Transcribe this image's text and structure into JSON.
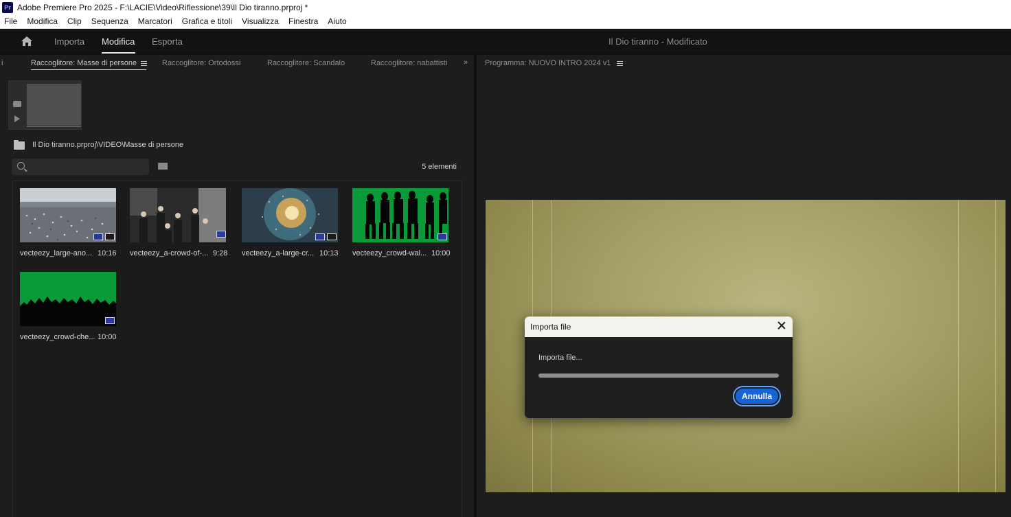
{
  "titlebar": {
    "app_icon": "Pr",
    "title": "Adobe Premiere Pro 2025 - F:\\LACIE\\Video\\Riflessione\\39\\Il Dio tiranno.prproj *"
  },
  "menu": [
    "File",
    "Modifica",
    "Clip",
    "Sequenza",
    "Marcatori",
    "Grafica e titoli",
    "Visualizza",
    "Finestra",
    "Aiuto"
  ],
  "workspace": {
    "tabs": [
      "Importa",
      "Modifica",
      "Esporta"
    ],
    "active_tab": "Modifica",
    "project_title": "Il Dio tiranno - Modificato"
  },
  "project_panel": {
    "tabs": [
      "Raccoglitore: Masse di persone",
      "Raccoglitore: Ortodossi",
      "Raccoglitore: Scandalo",
      "Raccoglitore: nabattisti"
    ],
    "active_tab": "Raccoglitore: Masse di persone",
    "left_fragment": "i",
    "more_icon": "»",
    "path": "Il Dio tiranno.prproj\\VIDEO\\Masse di persone",
    "search_placeholder": "",
    "item_count": "5 elementi",
    "clips": [
      {
        "name": "vecteezy_large-ano...",
        "duration": "10:16",
        "thumb": "crowd-city",
        "audio": true
      },
      {
        "name": "vecteezy_a-crowd-of-...",
        "duration": "9:28",
        "thumb": "crowd-street",
        "audio": false
      },
      {
        "name": "vecteezy_a-large-cr...",
        "duration": "10:13",
        "thumb": "crowd-aerial",
        "audio": true
      },
      {
        "name": "vecteezy_crowd-wal...",
        "duration": "10:00",
        "thumb": "greenscreen-walk",
        "audio": false
      },
      {
        "name": "vecteezy_crowd-che...",
        "duration": "10:00",
        "thumb": "greenscreen-cheer",
        "audio": false
      }
    ]
  },
  "program_monitor": {
    "title": "Programma: NUOVO INTRO 2024 v1"
  },
  "import_dialog": {
    "title": "Importa file",
    "status": "Importa file...",
    "progress": 1.0,
    "cancel_label": "Annulla"
  },
  "colors": {
    "accent_blue": "#1565d8",
    "green_screen": "#0a9a3a",
    "video_tint": "#a29d63"
  }
}
